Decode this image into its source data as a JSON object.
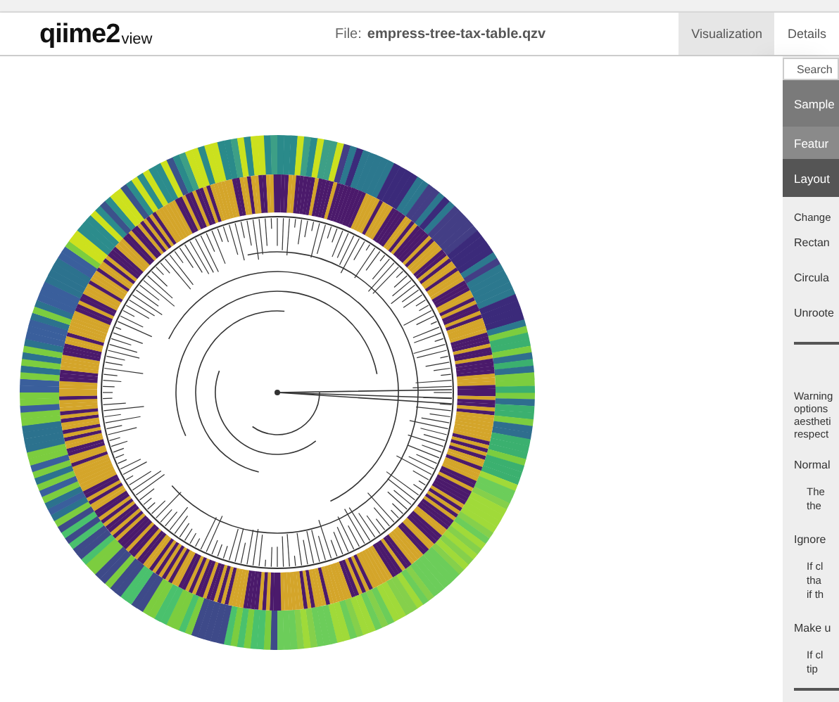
{
  "header": {
    "logo_main": "qiime2",
    "logo_sub": "view",
    "file_label": "File:",
    "file_name": "empress-tree-tax-table.qzv",
    "tabs": [
      {
        "label": "Visualization",
        "selected": true
      },
      {
        "label": "Details",
        "selected": false
      }
    ]
  },
  "sidebar": {
    "search": {
      "placeholder": "Search"
    },
    "sections": [
      {
        "label": "Sample",
        "expanded": false
      },
      {
        "label": "Featur",
        "expanded": false
      },
      {
        "label": "Layout",
        "expanded": true
      }
    ],
    "layout_panel": {
      "heading": "Change",
      "options": [
        "Rectan",
        "Circula",
        "Unroote"
      ],
      "warning": [
        "Warning",
        "options",
        "aestheti",
        "respect"
      ],
      "settings": [
        {
          "label": "Normal",
          "description": [
            "The",
            "the"
          ]
        },
        {
          "label": "Ignore",
          "description": [
            "If cl",
            "tha",
            "if th"
          ]
        },
        {
          "label": "Make u",
          "description": [
            "If cl",
            "tip"
          ]
        }
      ]
    }
  }
}
